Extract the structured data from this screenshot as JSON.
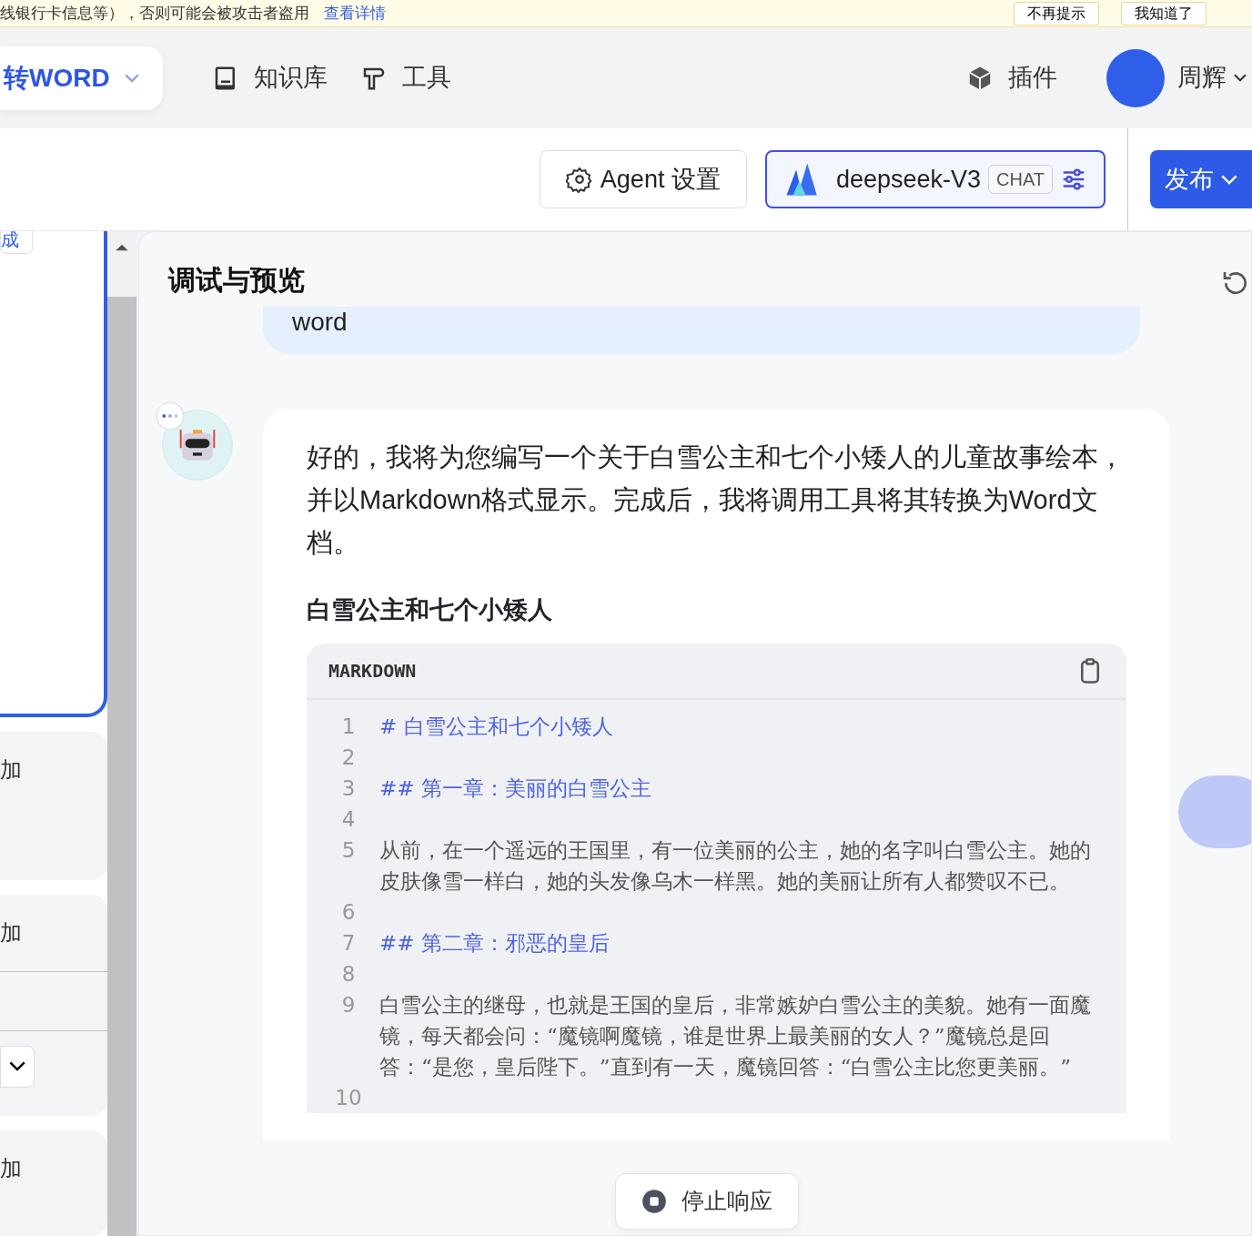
{
  "banner": {
    "text": "线银行卡信息等），否则可能会被攻击者盗用",
    "link": "查看详情",
    "buttons": [
      "不再提示",
      "我知道了"
    ]
  },
  "nav": {
    "agent_name": "转WORD",
    "items": [
      {
        "label": "知识库",
        "kind": "book"
      },
      {
        "label": "工具",
        "kind": "tool"
      }
    ],
    "plugins": "插件",
    "user": "周辉"
  },
  "toolbar": {
    "agent_settings": "Agent 设置",
    "model": {
      "name": "deepseek-V3",
      "tag": "CHAT"
    },
    "publish": "发布"
  },
  "sidebar": {
    "cards": [
      {
        "label": "成",
        "kind": "button",
        "selected": true
      },
      {
        "label": "加",
        "kind": "plain",
        "selected": false
      },
      {
        "label": "加",
        "kind": "dropdown",
        "selected": false
      },
      {
        "label": "加",
        "kind": "plain",
        "selected": false
      }
    ]
  },
  "chat": {
    "title": "调试与预览",
    "user_message": "word",
    "bot": {
      "paragraph": "好的，我将为您编写一个关于白雪公主和七个小矮人的儿童故事绘本，并以Markdown格式显示。完成后，我将调用工具将其转换为Word文档。",
      "heading": "白雪公主和七个小矮人",
      "code": {
        "language": "MARKDOWN",
        "lines": [
          {
            "number": "1",
            "kind": "heading",
            "text": "# 白雪公主和七个小矮人"
          },
          {
            "number": "2",
            "kind": "blank"
          },
          {
            "number": "3",
            "kind": "heading",
            "text": "## 第一章：美丽的白雪公主"
          },
          {
            "number": "4",
            "kind": "blank"
          },
          {
            "number": "5",
            "kind": "text",
            "text": "从前，在一个遥远的王国里，有一位美丽的公主，她的名字叫白雪公主。她的皮肤像雪一样白，她的头发像乌木一样黑。她的美丽让所有人都赞叹不已。"
          },
          {
            "number": "6",
            "kind": "blank"
          },
          {
            "number": "7",
            "kind": "heading",
            "text": "## 第二章：邪恶的皇后"
          },
          {
            "number": "8",
            "kind": "blank"
          },
          {
            "number": "9",
            "kind": "text",
            "text": "白雪公主的继母，也就是王国的皇后，非常嫉妒白雪公主的美貌。她有一面魔镜，每天都会问：“魔镜啊魔镜，谁是世界上最美丽的女人？”魔镜总是回答：“是您，皇后陛下。”直到有一天，魔镜回答：“白雪公主比您更美丽。”"
          },
          {
            "number": "10",
            "kind": "blank"
          }
        ]
      }
    },
    "stop_button": "停止响应"
  }
}
